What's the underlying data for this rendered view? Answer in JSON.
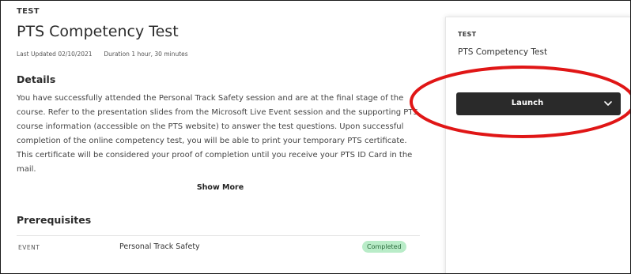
{
  "main": {
    "eyebrow": "TEST",
    "title": "PTS Competency Test",
    "last_updated_label": "Last Updated",
    "last_updated_value": "02/10/2021",
    "duration_label": "Duration",
    "duration_value": "1 hour, 30 minutes",
    "details_heading": "Details",
    "details_text": "You have successfully attended the Personal Track Safety session and are at the final stage of the course. Refer to the presentation slides from the Microsoft Live Event session and the supporting PTS course information (accessible on the PTS website) to answer the test questions. Upon successful completion of the online competency test, you will be able to print your temporary PTS certificate. This certificate will be considered your proof of completion until you receive your PTS ID Card in the mail.",
    "show_more": "Show More",
    "prerequisites_heading": "Prerequisites",
    "prerequisites": [
      {
        "type": "EVENT",
        "name": "Personal Track Safety",
        "status": "Completed"
      }
    ]
  },
  "side": {
    "eyebrow": "TEST",
    "title": "PTS Competency Test",
    "launch_label": "Launch"
  },
  "colors": {
    "launch_bg": "#2a2a2a",
    "badge_bg": "#b9ecc8",
    "badge_text": "#2b6b3d",
    "highlight_ring": "#e01616"
  },
  "icons": {
    "launch_dropdown": "chevron-down-icon"
  }
}
